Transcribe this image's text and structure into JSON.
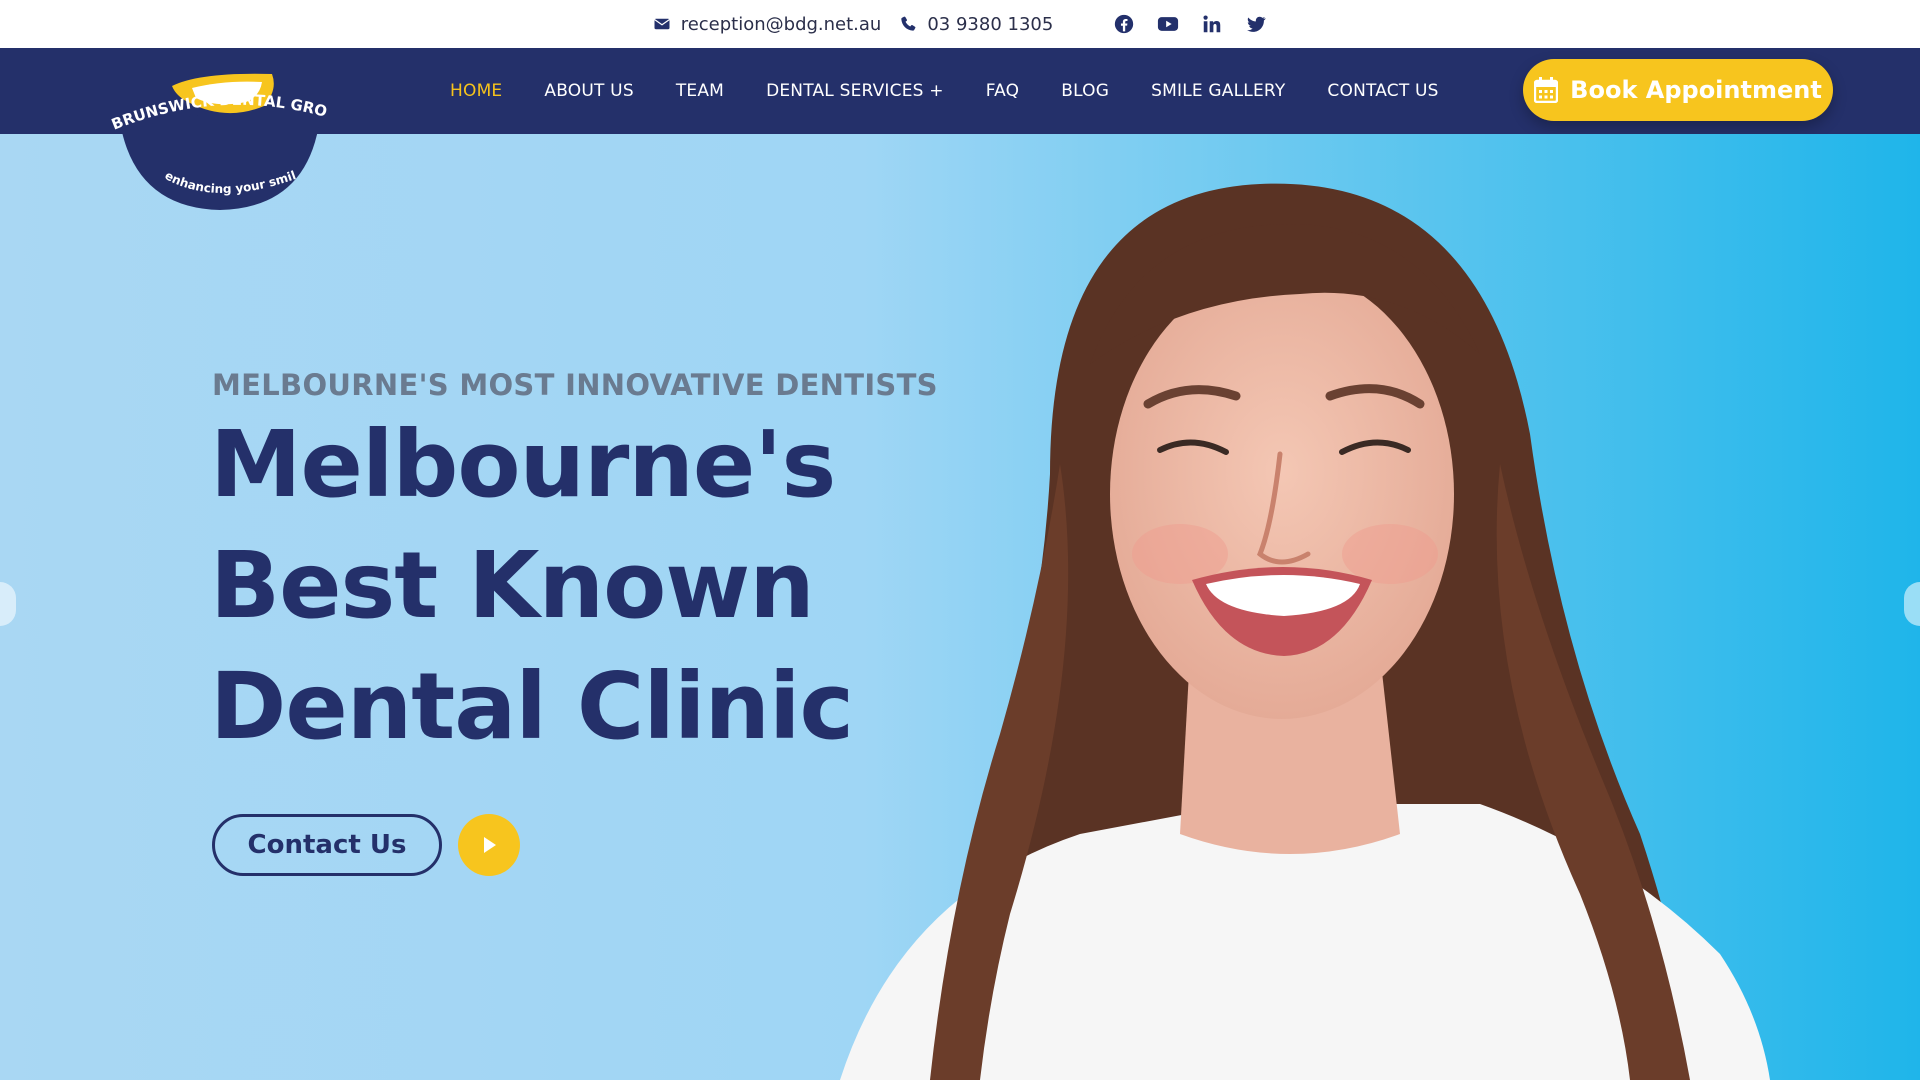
{
  "topbar": {
    "email": "reception@bdg.net.au",
    "phone": "03 9380 1305",
    "socials": [
      "facebook-icon",
      "youtube-icon",
      "linkedin-icon",
      "twitter-icon"
    ]
  },
  "logo": {
    "text": "BRUNSWICK DENTAL GROUP",
    "tagline": "enhancing your smile"
  },
  "nav": {
    "items": [
      {
        "label": "HOME",
        "active": true
      },
      {
        "label": "ABOUT US"
      },
      {
        "label": "TEAM"
      },
      {
        "label": "DENTAL SERVICES +"
      },
      {
        "label": "FAQ"
      },
      {
        "label": "BLOG"
      },
      {
        "label": "SMILE GALLERY"
      },
      {
        "label": "CONTACT US"
      }
    ],
    "cta": "Book Appointment"
  },
  "hero": {
    "eyebrow": "MELBOURNE'S MOST INNOVATIVE DENTISTS",
    "headline": [
      "Melbourne's",
      "Best Known",
      "Dental Clinic"
    ],
    "button_label": "Contact Us"
  },
  "colors": {
    "navy": "#24306a",
    "yellow": "#f7c51e",
    "active_nav": "#f6c31c",
    "hero_bg": "#9fd6f5"
  }
}
